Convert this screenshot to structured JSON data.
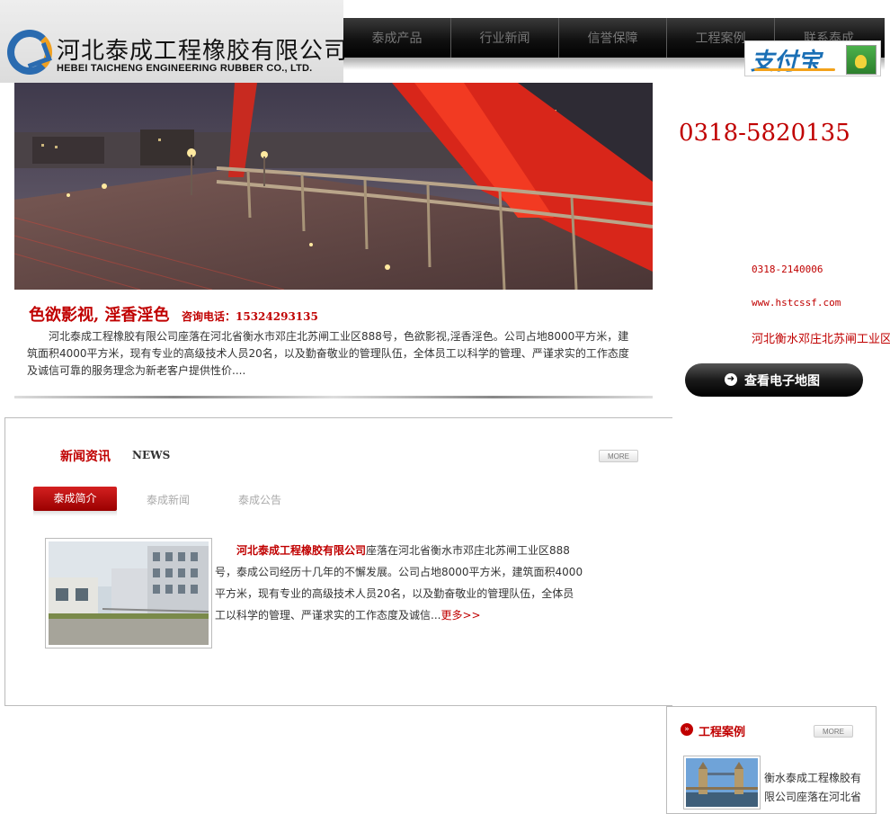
{
  "logo": {
    "name_cn": "河北泰成工程橡胶有限公司",
    "name_en": "HEBEI TAICHENG ENGINEERING RUBBER CO., LTD."
  },
  "nav": {
    "items": [
      "泰成产品",
      "行业新闻",
      "信誉保障",
      "工程案例",
      "联系泰成"
    ]
  },
  "payment": {
    "label": "支付宝"
  },
  "contact": {
    "big_phone": "0318-5820135",
    "phone2": "0318-2140006",
    "website": "www.hstcssf.com",
    "address": "河北衡水邓庄北苏闸工业区",
    "map_button": "查看电子地图"
  },
  "intro": {
    "title": "色欲影视, 淫香淫色",
    "phone_label": "咨询电话：15324293135",
    "text": "河北泰成工程橡胶有限公司座落在河北省衡水市邓庄北苏闸工业区888号，色欲影视,淫香淫色。公司占地8000平方米，建筑面积4000平方米，现有专业的高级技术人员20名，以及勤奋敬业的管理队伍，全体员工以科学的管理、严谨求实的工作态度及诚信可靠的服务理念为新老客户提供性价...."
  },
  "news": {
    "title": "新闻资讯",
    "title_en": "NEWS",
    "more": "MORE",
    "tabs": [
      "泰成简介",
      "泰成新闻",
      "泰成公告"
    ],
    "company": "河北泰成工程橡胶有限公司",
    "body": "座落在河北省衡水市邓庄北苏闸工业区888号，泰成公司经历十几年的不懈发展。公司占地8000平方米，建筑面积4000平方米，现有专业的高级技术人员20名，以及勤奋敬业的管理队伍，全体员工以科学的管理、严谨求实的工作态度及诚信...",
    "more_link": "更多>>"
  },
  "cases": {
    "title": "工程案例",
    "more": "MORE",
    "text": "衡水泰成工程橡胶有限公司座落在河北省"
  },
  "icons": {
    "map_button": "arrow-right-circle-icon",
    "cases_title": "chevron-circle-icon"
  },
  "colors": {
    "accent": "#c00000",
    "nav_bg": "#111111",
    "map_button": "#1a1a1a"
  }
}
